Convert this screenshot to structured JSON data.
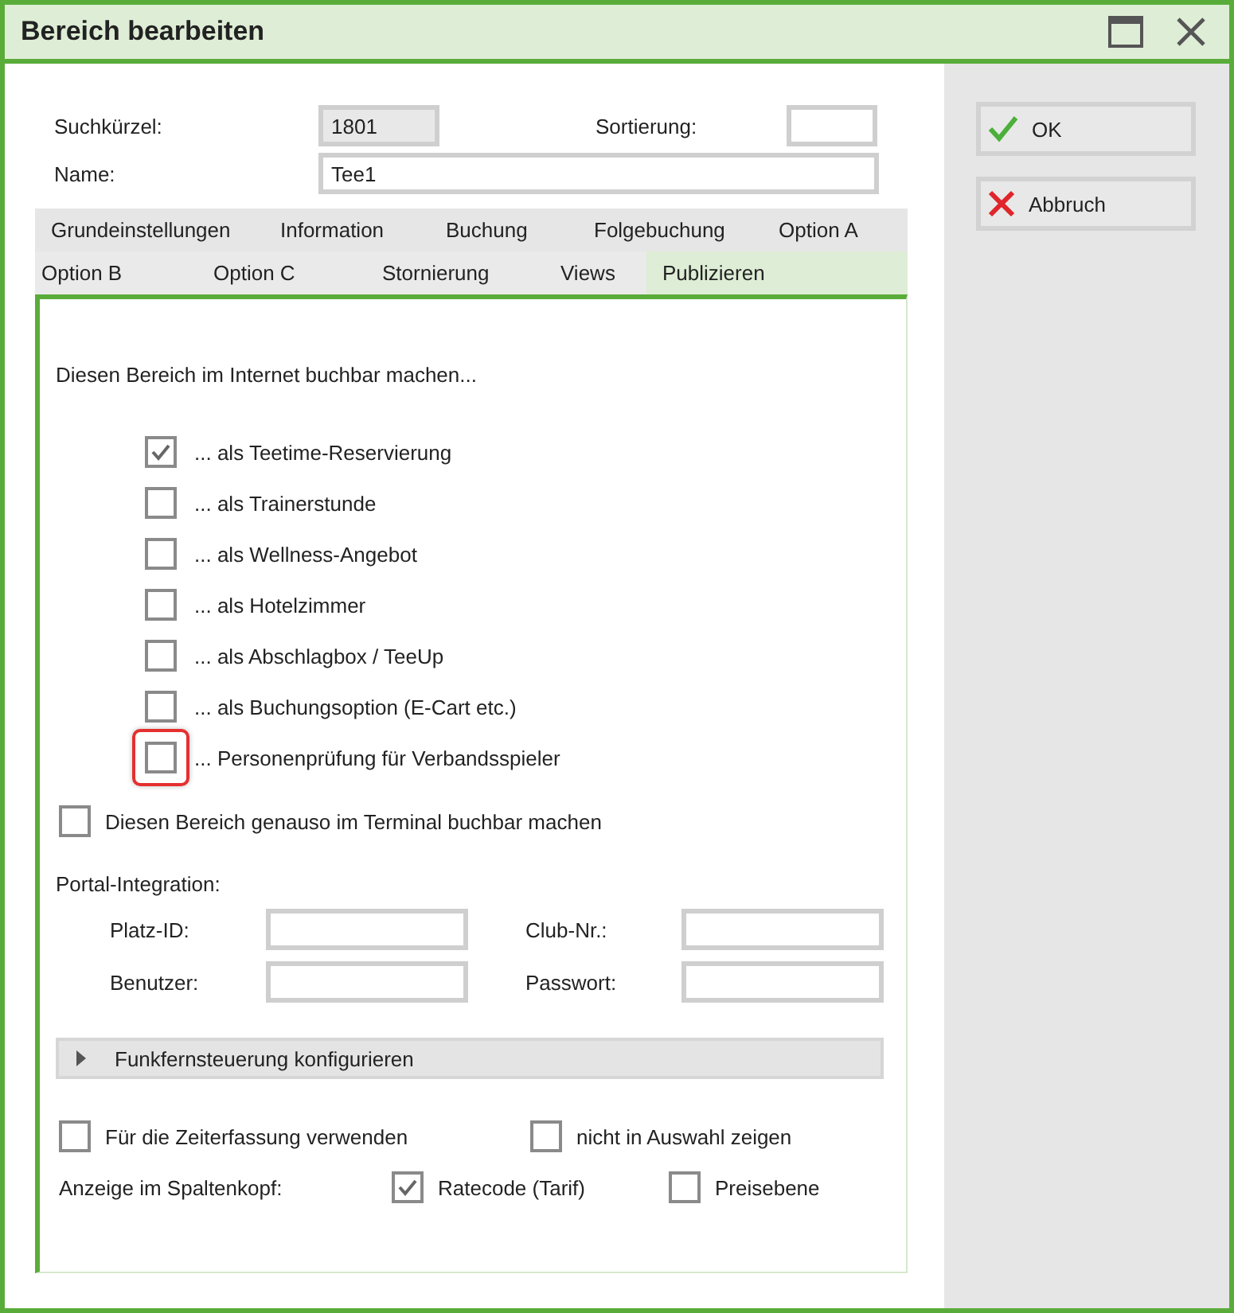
{
  "window": {
    "title": "Bereich bearbeiten"
  },
  "header": {
    "search_label": "Suchkürzel:",
    "search_value": "1801",
    "sort_label": "Sortierung:",
    "name_label": "Name:",
    "name_value": "Tee1"
  },
  "buttons": [
    {
      "label": "OK",
      "kind": "ok"
    },
    {
      "label": "Abbruch",
      "kind": "cancel"
    }
  ],
  "tab_rows": [
    [
      {
        "label": "Grundeinstellungen",
        "selected": false
      },
      {
        "label": "Information",
        "selected": false
      },
      {
        "label": "Buchung",
        "selected": false
      },
      {
        "label": "Folgebuchung",
        "selected": false
      },
      {
        "label": "Option A",
        "selected": false
      }
    ],
    [
      {
        "label": "Option B",
        "selected": false
      },
      {
        "label": "Option C",
        "selected": false
      },
      {
        "label": "Stornierung",
        "selected": false
      },
      {
        "label": "Views",
        "selected": false
      },
      {
        "label": "Publizieren",
        "selected": true
      }
    ]
  ],
  "internet": {
    "heading": "Diesen Bereich im Internet buchbar machen...",
    "options": [
      {
        "label": "... als Teetime-Reservierung",
        "checked": true,
        "highlighted": false
      },
      {
        "label": "... als Trainerstunde",
        "checked": false,
        "highlighted": false
      },
      {
        "label": "... als Wellness-Angebot",
        "checked": false,
        "highlighted": false
      },
      {
        "label": "... als Hotelzimmer",
        "checked": false,
        "highlighted": false
      },
      {
        "label": "... als Abschlagbox / TeeUp",
        "checked": false,
        "highlighted": false
      },
      {
        "label": "... als Buchungsoption (E-Cart etc.)",
        "checked": false,
        "highlighted": false
      },
      {
        "label": "... Personenprüfung für Verbandsspieler",
        "checked": false,
        "highlighted": true
      }
    ]
  },
  "terminal": {
    "label": "Diesen Bereich genauso im Terminal buchbar machen",
    "checked": false
  },
  "portal": {
    "heading": "Portal-Integration:",
    "fields": [
      {
        "label": "Platz-ID:"
      },
      {
        "label": "Club-Nr.:"
      },
      {
        "label": "Benutzer:"
      },
      {
        "label": "Passwort:"
      }
    ]
  },
  "remote": {
    "label": "Funkfernsteuerung konfigurieren",
    "expanded": false
  },
  "bottom_checks": [
    {
      "label": "Für die Zeiterfassung verwenden",
      "checked": false
    },
    {
      "label": "nicht in Auswahl zeigen",
      "checked": false
    }
  ],
  "column_header": {
    "label": "Anzeige im Spaltenkopf:",
    "options": [
      {
        "label": "Ratecode (Tarif)",
        "checked": true
      },
      {
        "label": "Preisebene",
        "checked": false
      }
    ]
  }
}
